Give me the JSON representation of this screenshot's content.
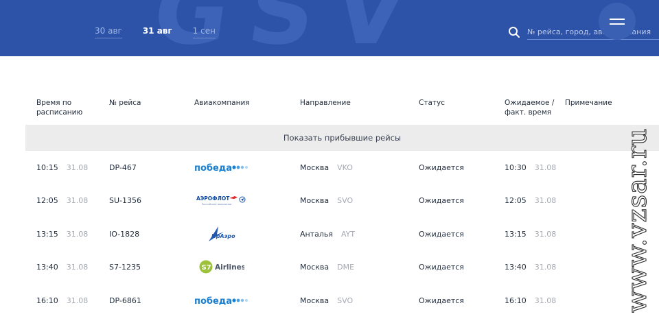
{
  "header": {
    "logo_text": "GSV",
    "date_tabs": [
      {
        "label": "30 авг",
        "active": false
      },
      {
        "label": "31 авг",
        "active": true
      },
      {
        "label": "1 сен",
        "active": false
      }
    ],
    "search": {
      "placeholder": "№ рейса, город, авиакомпания",
      "icon": "search-icon"
    },
    "menu_icon": "hamburger-icon"
  },
  "table": {
    "columns": {
      "sched_time": "Время по расписанию",
      "flight_no": "№ рейса",
      "airline": "Авиакомпания",
      "direction": "Направление",
      "status": "Статус",
      "expected_time": "Ожидаемое / факт. время",
      "note": "Примечание"
    },
    "show_arrived_label": "Показать прибывшие рейсы",
    "rows": [
      {
        "time": "10:15",
        "date": "31.08",
        "flight": "DP-467",
        "airline": "победа",
        "city": "Москва",
        "code": "VKO",
        "status": "Ожидается",
        "exp_time": "10:30",
        "exp_date": "31.08"
      },
      {
        "time": "12:05",
        "date": "31.08",
        "flight": "SU-1356",
        "airline": "АЭРОФЛОТ",
        "city": "Москва",
        "code": "SVO",
        "status": "Ожидается",
        "exp_time": "12:05",
        "exp_date": "31.08"
      },
      {
        "time": "13:15",
        "date": "31.08",
        "flight": "IO-1828",
        "airline": "ИрАэро",
        "city": "Анталья",
        "code": "AYT",
        "status": "Ожидается",
        "exp_time": "13:15",
        "exp_date": "31.08"
      },
      {
        "time": "13:40",
        "date": "31.08",
        "flight": "S7-1235",
        "airline": "Airlines",
        "city": "Москва",
        "code": "DME",
        "status": "Ожидается",
        "exp_time": "13:40",
        "exp_date": "31.08"
      },
      {
        "time": "16:10",
        "date": "31.08",
        "flight": "DP-6861",
        "airline": "победа",
        "city": "Москва",
        "code": "SVO",
        "status": "Ожидается",
        "exp_time": "16:10",
        "exp_date": "31.08"
      }
    ]
  },
  "logos": {
    "aeroflot_subtext": "Российские авиалинии",
    "s7_badge": "S7"
  },
  "watermark": "www.vzsar.ru",
  "colors": {
    "header_bg": "#2d53a8",
    "pobeda_blue": "#1a7fd0",
    "s7_green": "#9cc23b",
    "aeroflot_blue": "#0e4aa0",
    "iraero_blue": "#2258b0"
  }
}
